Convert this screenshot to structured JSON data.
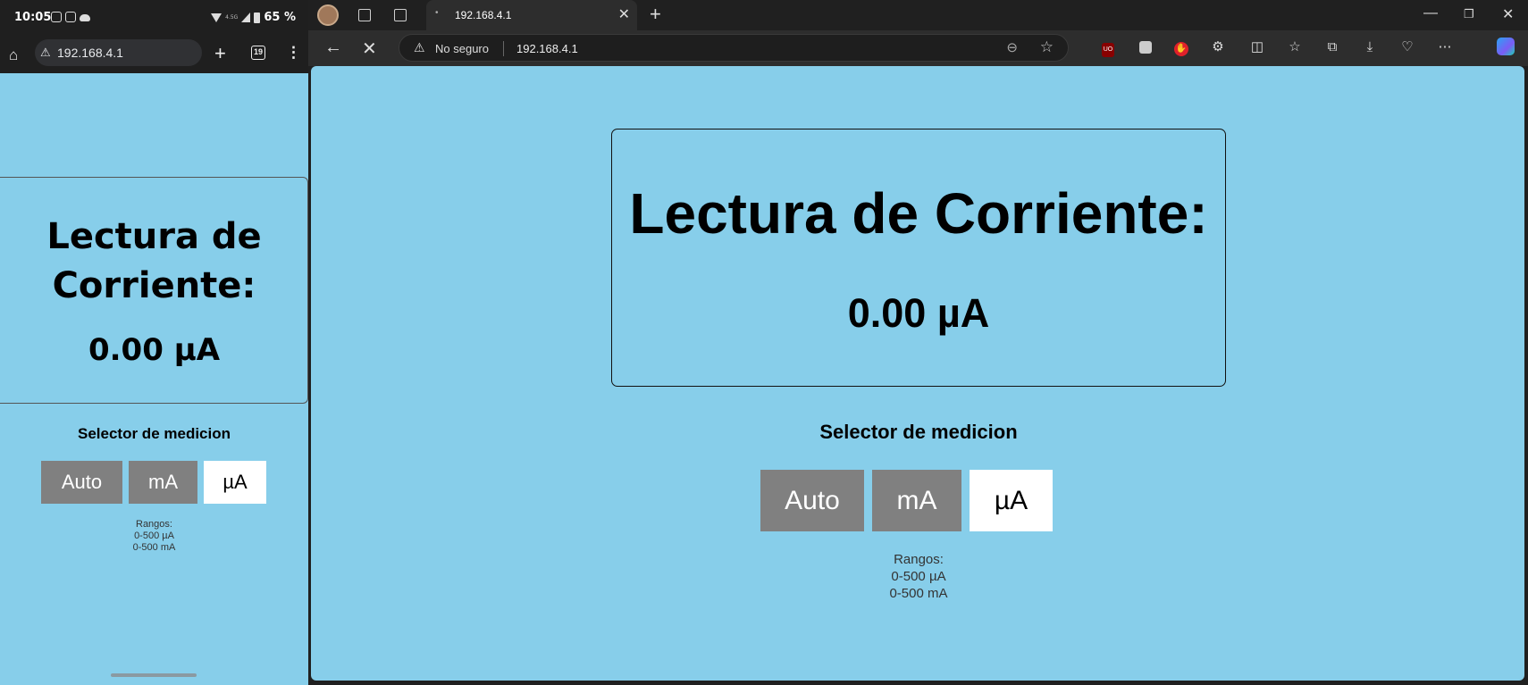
{
  "phone": {
    "time": "10:05",
    "network_tag": "4.5G",
    "battery": "65 %",
    "url": "192.168.4.1",
    "tab_count": "19",
    "heading": "Lectura de Corriente:",
    "value": "0.00 µA",
    "selector_label": "Selector de medicion",
    "buttons": {
      "auto": "Auto",
      "ma": "mA",
      "ua": "µA"
    },
    "ranges": {
      "title": "Rangos:",
      "r1": "0-500 µA",
      "r2": "0-500 mA"
    }
  },
  "browser": {
    "tab_title": "192.168.4.1",
    "security_label": "No seguro",
    "url": "192.168.4.1",
    "extension_ublock": "UO",
    "page": {
      "heading": "Lectura de Corriente:",
      "value": "0.00 µA",
      "selector_label": "Selector de medicion",
      "buttons": {
        "auto": "Auto",
        "ma": "mA",
        "ua": "µA"
      },
      "active_button": "ua",
      "ranges": {
        "title": "Rangos:",
        "r1": "0-500 µA",
        "r2": "0-500 mA"
      }
    }
  },
  "colors": {
    "page_bg": "#87ceea",
    "button_bg": "#808080",
    "button_active_bg": "#ffffff",
    "chrome_dark": "#202020"
  },
  "icons": [
    "home-icon",
    "warning-icon",
    "plus-icon",
    "tabs-icon",
    "more-icon",
    "back-icon",
    "stop-icon",
    "zoom-out-icon",
    "star-icon",
    "close-icon",
    "minimize-icon",
    "restore-icon"
  ]
}
